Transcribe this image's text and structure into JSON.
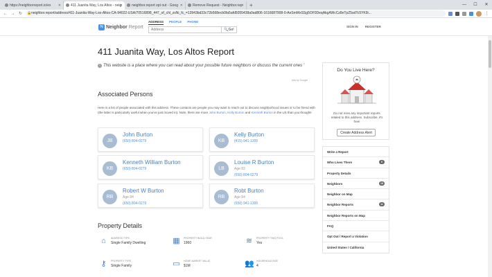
{
  "browser": {
    "tabs": [
      {
        "label": "https://neighborreport.io/ex"
      },
      {
        "label": "411 Juanita Way, Los Altos - neig"
      },
      {
        "label": "neighbor.report opt out - Goog"
      },
      {
        "label": "Remove Request - Neighbor.rep"
      }
    ],
    "url": "neighbor.report/address/411-Juanita-Way-Los-Altos-CA-94022-USA/70516898_447_of_chl_zsNi_fc_=13943bd33c72b568ecb0fa5afd5055438a0ad806-1616687908-0-AeSmMxSSg5OF0DeqAkgAWcCz8eTpZ5sdTc5YK9i..."
  },
  "site": {
    "brand": "Neighbor",
    "brand_suffix": "Report",
    "search_tabs": [
      "ADDRESS",
      "PEOPLE",
      "PHONE"
    ],
    "search_placeholder": "Address",
    "search_button": "Go!",
    "signin": "SIGN IN",
    "register": "REGISTER"
  },
  "main": {
    "title": "411 Juanita Way, Los Altos Report",
    "intro": "This website is a place where you can read about your possible future neighbors or discuss the current ones",
    "ads_by": "Ads by Google",
    "associated_heading": "Associated Persons",
    "blurb_pre": "Here is a list of people associated with this address. These contacts are people you may want to reach out to discuss neighborhood issues or to be friend with (the latter is particularly useful when you've just moved in). Note, there are more",
    "blurb_link1": "John Burton",
    "blurb_link2": "Kelly Burton",
    "blurb_and": "and",
    "blurb_link3": "Kenneth Burton",
    "blurb_post": "in the US than you thought!",
    "persons": [
      {
        "initials": "JB",
        "name": "John Burton",
        "line2": "(650) 804-0279",
        "line3": ""
      },
      {
        "initials": "KB",
        "name": "Kelly Burton",
        "line2": "(415) 941-1300",
        "line3": ""
      },
      {
        "initials": "KB",
        "name": "Kenneth William Burton",
        "line2": "(650) 804-0279",
        "line3": ""
      },
      {
        "initials": "LB",
        "name": "Louise R Burton",
        "line2": "Age 82",
        "line3": "(650) 804-0279"
      },
      {
        "initials": "RB",
        "name": "Robert W Burton",
        "line2": "Age 84",
        "line3": "(650) 804-0279"
      },
      {
        "initials": "RB",
        "name": "Robt Burton",
        "line2": "Age 84",
        "line3": "(650) 941-1300"
      }
    ],
    "property_heading": "Property Details",
    "property": [
      {
        "label": "ADDRESS TYPE",
        "value": "Single Family Dwelling",
        "icon": "house-icon"
      },
      {
        "label": "PROPERTY BUILD YEAR",
        "value": "1960",
        "icon": "brick-icon"
      },
      {
        "label": "PROPERTY TWO POOL",
        "value": "Yes",
        "icon": "pool-icon"
      },
      {
        "label": "PROPERTY TYPE",
        "value": "Single Family",
        "icon": "key-icon"
      },
      {
        "label": "HOME MARKET VALUE",
        "value": "$1M",
        "icon": "money-icon"
      },
      {
        "label": "HOUSEHOLD SIZE",
        "value": "4",
        "icon": "people-icon"
      }
    ]
  },
  "sidebar": {
    "dylh_title": "Do You Live Here?",
    "dylh_text": "Do not miss any important reports related to this address. Subscribe, it's free!",
    "dylh_button": "Create Address Alert",
    "menu": [
      {
        "label": "Write a Report",
        "badge": ""
      },
      {
        "label": "Who Lives There",
        "badge": "6"
      },
      {
        "label": "Property Details",
        "badge": ""
      },
      {
        "label": "Neighbors",
        "badge": "18"
      },
      {
        "label": "Neighbor on Map",
        "badge": ""
      },
      {
        "label": "Neighbor Reports",
        "badge": "11"
      },
      {
        "label": "Neighbor Reports on Map",
        "badge": ""
      },
      {
        "label": "FAQ",
        "badge": ""
      },
      {
        "label": "Opt Out / Report a Violation",
        "badge": ""
      },
      {
        "label": "United States / California",
        "badge": ""
      }
    ]
  }
}
